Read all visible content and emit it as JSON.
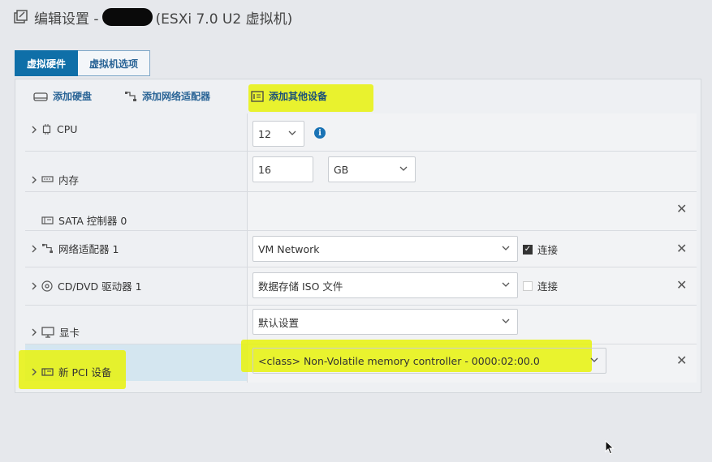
{
  "title": {
    "prefix": "编辑设置 - ",
    "suffix": "(ESXi 7.0 U2 虚拟机)"
  },
  "tabs": [
    {
      "label": "虚拟硬件"
    },
    {
      "label": "虚拟机选项"
    }
  ],
  "toolbar": {
    "add_disk": "添加硬盘",
    "add_network": "添加网络适配器",
    "add_other": "添加其他设备"
  },
  "devices": {
    "cpu": {
      "label": "CPU",
      "value": "12"
    },
    "memory": {
      "label": "内存",
      "value": "16",
      "unit": "GB"
    },
    "sata": {
      "label": "SATA 控制器 0"
    },
    "network": {
      "label": "网络适配器 1",
      "value": "VM Network",
      "connect_label": "连接",
      "connected": true
    },
    "cddvd": {
      "label": "CD/DVD 驱动器 1",
      "value": "数据存储 ISO 文件",
      "connect_label": "连接",
      "connected": false
    },
    "display": {
      "label": "显卡",
      "value": "默认设置"
    },
    "pci": {
      "label": "新 PCI 设备",
      "value": "<class> Non-Volatile memory controller - 0000:02:00.0"
    }
  },
  "colors": {
    "accent": "#0f6fa8",
    "highlight": "#e8f20a"
  }
}
